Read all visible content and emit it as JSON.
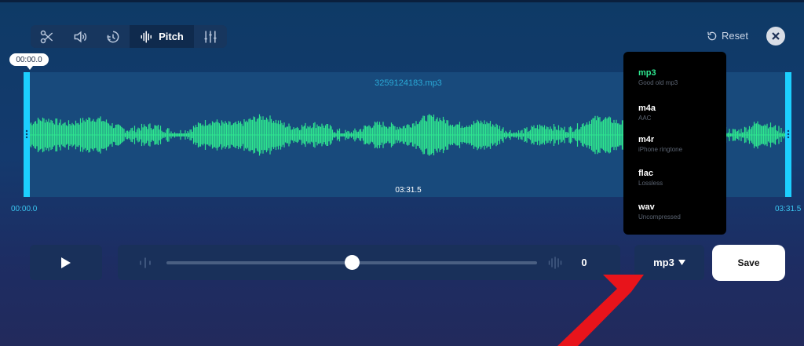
{
  "toolbar": {
    "tools": [
      {
        "icon": "scissors-icon"
      },
      {
        "icon": "volume-icon"
      },
      {
        "icon": "speed-icon"
      },
      {
        "icon": "pitch-waveform-icon",
        "label": "Pitch",
        "active": true
      },
      {
        "icon": "equalizer-icon"
      }
    ]
  },
  "header": {
    "reset_label": "Reset",
    "close_icon": "close-icon"
  },
  "waveform": {
    "filename": "3259124183.mp3",
    "cursor_time": "00:00.0",
    "duration": "03:31.5",
    "start_time": "00:00.0",
    "end_time": "03:31.5",
    "wave_color": "#2ee68f",
    "handle_color": "#1ccfff"
  },
  "format_menu": {
    "options": [
      {
        "name": "mp3",
        "desc": "Good old mp3",
        "selected": true
      },
      {
        "name": "m4a",
        "desc": "AAC"
      },
      {
        "name": "m4r",
        "desc": "iPhone ringtone"
      },
      {
        "name": "flac",
        "desc": "Lossless"
      },
      {
        "name": "wav",
        "desc": "Uncompressed"
      }
    ]
  },
  "controls": {
    "pitch_value": "0",
    "pitch_slider_fraction": 0.5,
    "format_label": "mp3",
    "save_label": "Save"
  },
  "colors": {
    "accent": "#2ee68f",
    "annotation_arrow": "#e8141b"
  }
}
